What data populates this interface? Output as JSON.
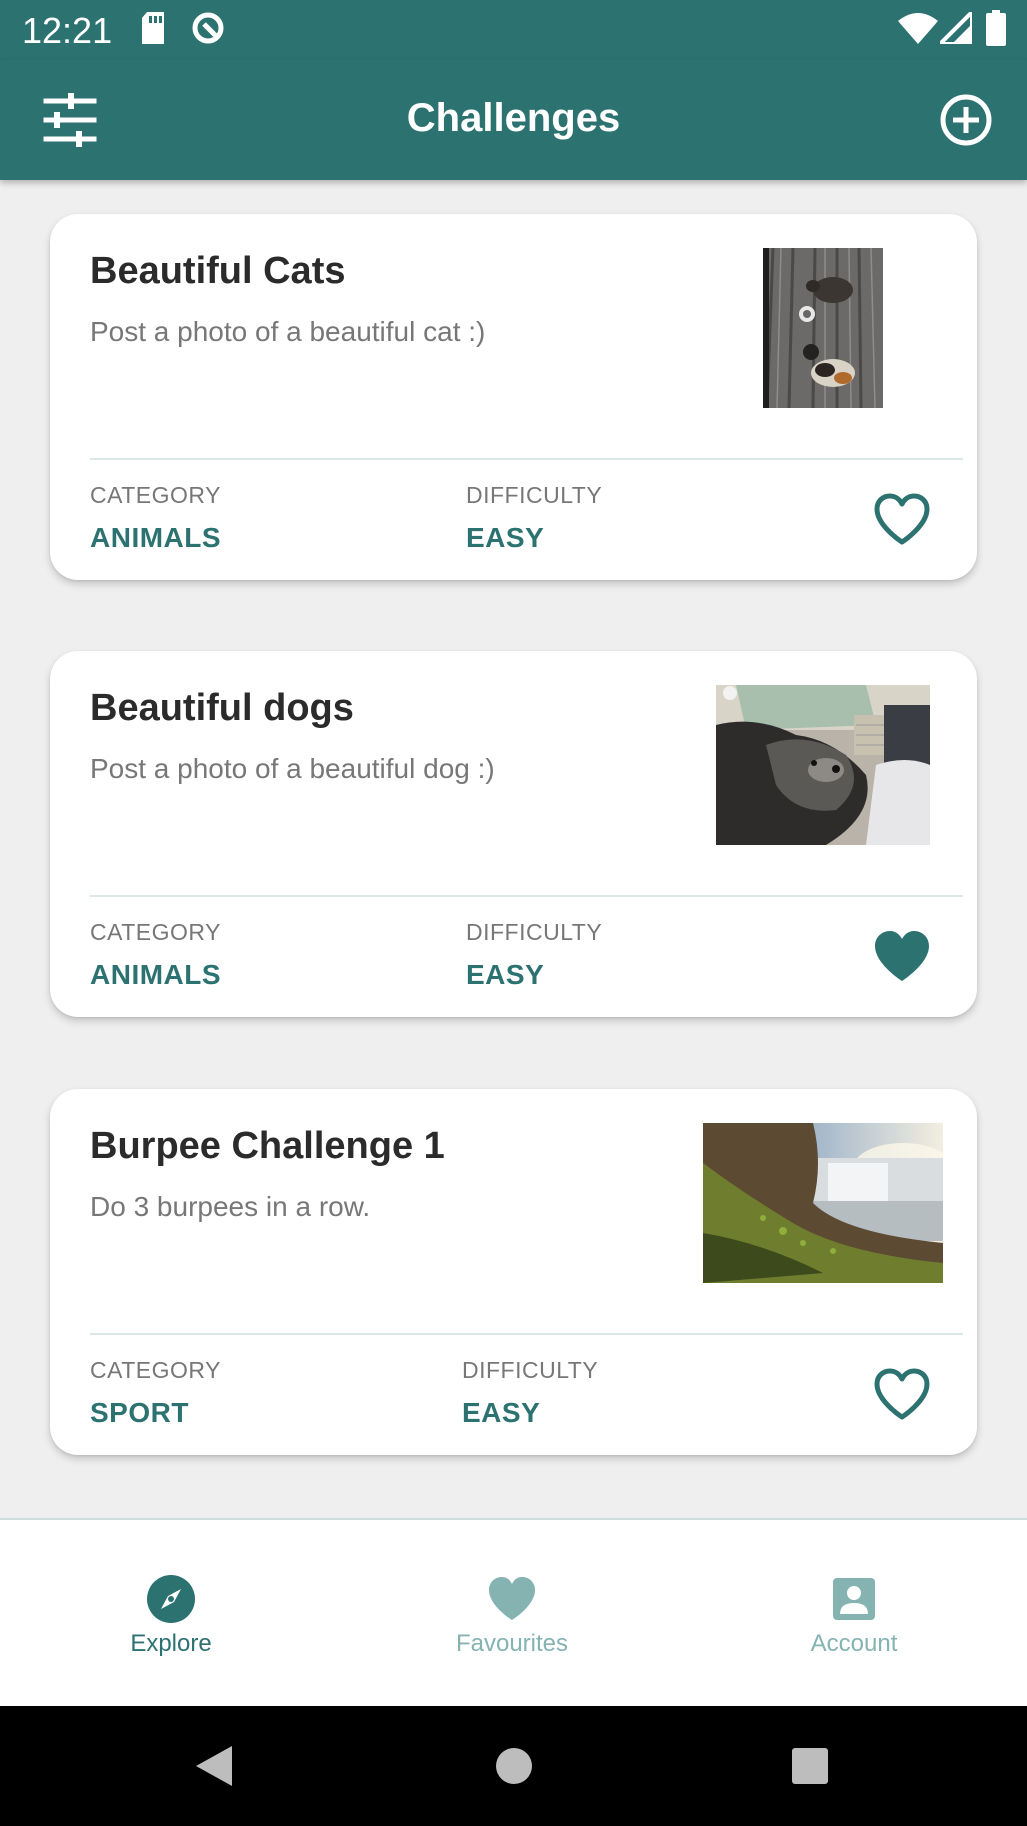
{
  "status_bar": {
    "time": "12:21",
    "left_icons": [
      "sd-card-icon",
      "sync-icon"
    ],
    "right_icons": [
      "wifi-icon",
      "cell-signal-icon",
      "battery-icon"
    ]
  },
  "app_bar": {
    "title": "Challenges",
    "left_icon": "tune-icon",
    "right_icon": "add-circle-icon"
  },
  "labels": {
    "category": "CATEGORY",
    "difficulty": "DIFFICULTY"
  },
  "challenges": [
    {
      "title": "Beautiful Cats",
      "description": "Post a photo of a beautiful cat :)",
      "category": "ANIMALS",
      "difficulty": "EASY",
      "favourite": false,
      "image": "cats-photo"
    },
    {
      "title": "Beautiful dogs",
      "description": "Post a photo of a beautiful dog :)",
      "category": "ANIMALS",
      "difficulty": "EASY",
      "favourite": true,
      "image": "dog-photo"
    },
    {
      "title": "Burpee Challenge 1",
      "description": "Do 3 burpees in a row.",
      "category": "SPORT",
      "difficulty": "EASY",
      "favourite": false,
      "image": "waterfall-photo"
    }
  ],
  "bottom_nav": [
    {
      "label": "Explore",
      "icon": "compass-icon",
      "active": true
    },
    {
      "label": "Favourites",
      "icon": "heart-icon",
      "active": false
    },
    {
      "label": "Account",
      "icon": "account-box-icon",
      "active": false
    }
  ],
  "system_nav": [
    "back-icon",
    "home-icon",
    "recents-icon"
  ],
  "colors": {
    "primary": "#2c7271",
    "inactive": "#84b3b2",
    "background": "#efefef",
    "card": "#ffffff"
  }
}
